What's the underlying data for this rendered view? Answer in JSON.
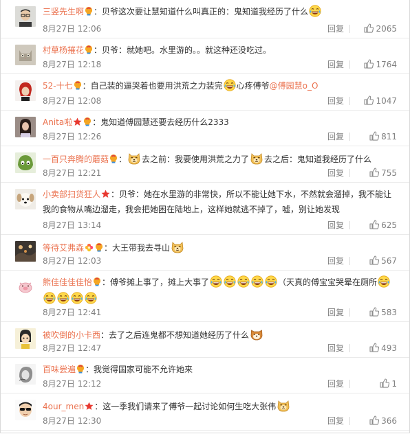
{
  "colors": {
    "username": "#eb7350",
    "text": "#333333",
    "meta": "#808080",
    "divider": "#eaeaea"
  },
  "comments": [
    {
      "username": "三竖先生啊",
      "badges": [
        "vip-bulb"
      ],
      "parts": [
        {
          "t": "text",
          "v": "：贝爷这次要让慧知道什么叫真正的：鬼知道我经历了什么"
        },
        {
          "t": "emoji",
          "v": "laugh-cry"
        }
      ],
      "time": "8月27日 12:06",
      "reply_label": "回复",
      "likes": "2065",
      "avatar": "avatar-man-glasses"
    },
    {
      "username": "村草杨摧花",
      "badges": [
        "vip-bulb"
      ],
      "parts": [
        {
          "t": "text",
          "v": "：贝爷：就她吧。水里游的。。就这种还没吃过。"
        }
      ],
      "time": "8月27日 12:18",
      "reply_label": "回复",
      "likes": "1764",
      "avatar": "avatar-cat"
    },
    {
      "username": "52-十七",
      "badges": [
        "vip-bulb"
      ],
      "parts": [
        {
          "t": "text",
          "v": "：自己装的逼哭着也要用洪荒之力装完"
        },
        {
          "t": "emoji",
          "v": "laugh-cry"
        },
        {
          "t": "text",
          "v": "心疼傅爷"
        },
        {
          "t": "link",
          "v": "@傅园慧o_O"
        }
      ],
      "time": "8月27日 12:08",
      "reply_label": "回复",
      "likes": "1047",
      "avatar": "avatar-redhead"
    },
    {
      "username": "Anita啦",
      "badges": [
        "red-star",
        "vip-bulb"
      ],
      "parts": [
        {
          "t": "text",
          "v": "：鬼知道傅园慧还要去经历什么2333"
        }
      ],
      "time": "8月27日 12:26",
      "reply_label": "回复",
      "likes": "811",
      "avatar": "avatar-girl"
    },
    {
      "username": "一百只奔腾的蘑菇",
      "badges": [
        "vip-bulb"
      ],
      "parts": [
        {
          "t": "text",
          "v": "："
        },
        {
          "t": "emoji",
          "v": "doge"
        },
        {
          "t": "text",
          "v": "去之前：我要使用洪荒之力了"
        },
        {
          "t": "emoji",
          "v": "doge"
        },
        {
          "t": "text",
          "v": "去之后：鬼知道我经历了什么"
        }
      ],
      "time": "8月27日 12:21",
      "reply_label": "回复",
      "likes": "755",
      "avatar": "avatar-green"
    },
    {
      "username": "小卖部扫货狂人",
      "badges": [
        "red-star"
      ],
      "parts": [
        {
          "t": "text",
          "v": "：贝爷：她在水里游的非常快，所以不能让她下水，不然就会溜掉，我不能让我的食物从嘴边溜走，我会把她困在陆地上，这样她就逃不掉了，嘘，别让她发现"
        }
      ],
      "time": "8月27日 13:14",
      "reply_label": "回复",
      "likes": "625",
      "avatar": "avatar-dog"
    },
    {
      "username": "等待艾弗森",
      "badges": [
        "flower",
        "vip-bulb"
      ],
      "parts": [
        {
          "t": "text",
          "v": "：大王带我去寻山"
        },
        {
          "t": "emoji",
          "v": "doge"
        }
      ],
      "time": "8月27日 12:03",
      "reply_label": "回复",
      "likes": "567",
      "avatar": "avatar-dark"
    },
    {
      "username": "熊佳佳佳佳怡",
      "badges": [
        "vip-bulb"
      ],
      "parts": [
        {
          "t": "text",
          "v": "：傅爷摊上事了，摊上大事了"
        },
        {
          "t": "emoji",
          "v": "laugh-cry"
        },
        {
          "t": "emoji",
          "v": "laugh-cry"
        },
        {
          "t": "emoji",
          "v": "laugh-cry"
        },
        {
          "t": "emoji",
          "v": "laugh-cry"
        },
        {
          "t": "emoji",
          "v": "laugh-cry"
        },
        {
          "t": "text",
          "v": "（天真的傅宝宝哭晕在厕所"
        },
        {
          "t": "emoji",
          "v": "laugh-cry"
        },
        {
          "t": "emoji",
          "v": "laugh-cry"
        },
        {
          "t": "emoji",
          "v": "laugh-cry"
        },
        {
          "t": "emoji",
          "v": "laugh-cry"
        },
        {
          "t": "emoji",
          "v": "laugh-cry"
        }
      ],
      "time": "8月27日 12:41",
      "reply_label": "回复",
      "likes": "583",
      "avatar": "avatar-pig"
    },
    {
      "username": "被吹倒的小卡西",
      "badges": [],
      "parts": [
        {
          "t": "text",
          "v": "：去了之后连鬼都不想知道她经历了什么"
        },
        {
          "t": "emoji",
          "v": "shiba"
        }
      ],
      "time": "8月27日 12:47",
      "reply_label": "回复",
      "likes": "493",
      "avatar": "avatar-cartoon"
    },
    {
      "username": "百味尝遍",
      "badges": [
        "vip-bulb"
      ],
      "parts": [
        {
          "t": "text",
          "v": "：我觉得国家可能不允许她来"
        }
      ],
      "time": "8月27日 12:12",
      "reply_label": "回复",
      "likes": "1",
      "avatar": "avatar-sketch"
    },
    {
      "username": "4our_men",
      "badges": [
        "red-star"
      ],
      "parts": [
        {
          "t": "text",
          "v": "：这一季我们请来了傅爷一起讨论如何生吃大张伟"
        },
        {
          "t": "emoji",
          "v": "doge"
        }
      ],
      "time": "8月27日 12:30",
      "reply_label": "回复",
      "likes": "366",
      "avatar": "avatar-sunglasses"
    }
  ]
}
